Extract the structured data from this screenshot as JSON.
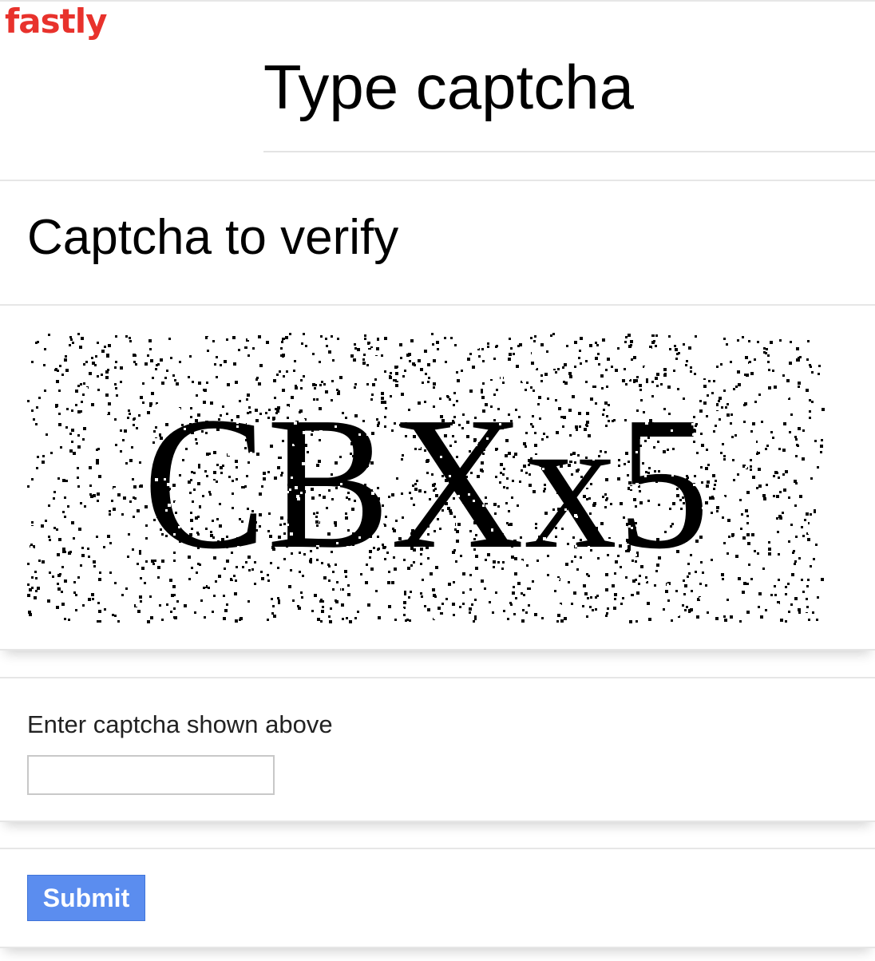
{
  "brand": {
    "logo_text": "fastly",
    "logo_color": "#e8322c"
  },
  "page": {
    "title": "Type captcha"
  },
  "captcha": {
    "header": "Captcha to verify",
    "image_text": "CBXx5",
    "input_label": "Enter captcha shown above",
    "input_value": "",
    "input_placeholder": ""
  },
  "actions": {
    "submit_label": "Submit",
    "submit_color": "#5b8def"
  }
}
